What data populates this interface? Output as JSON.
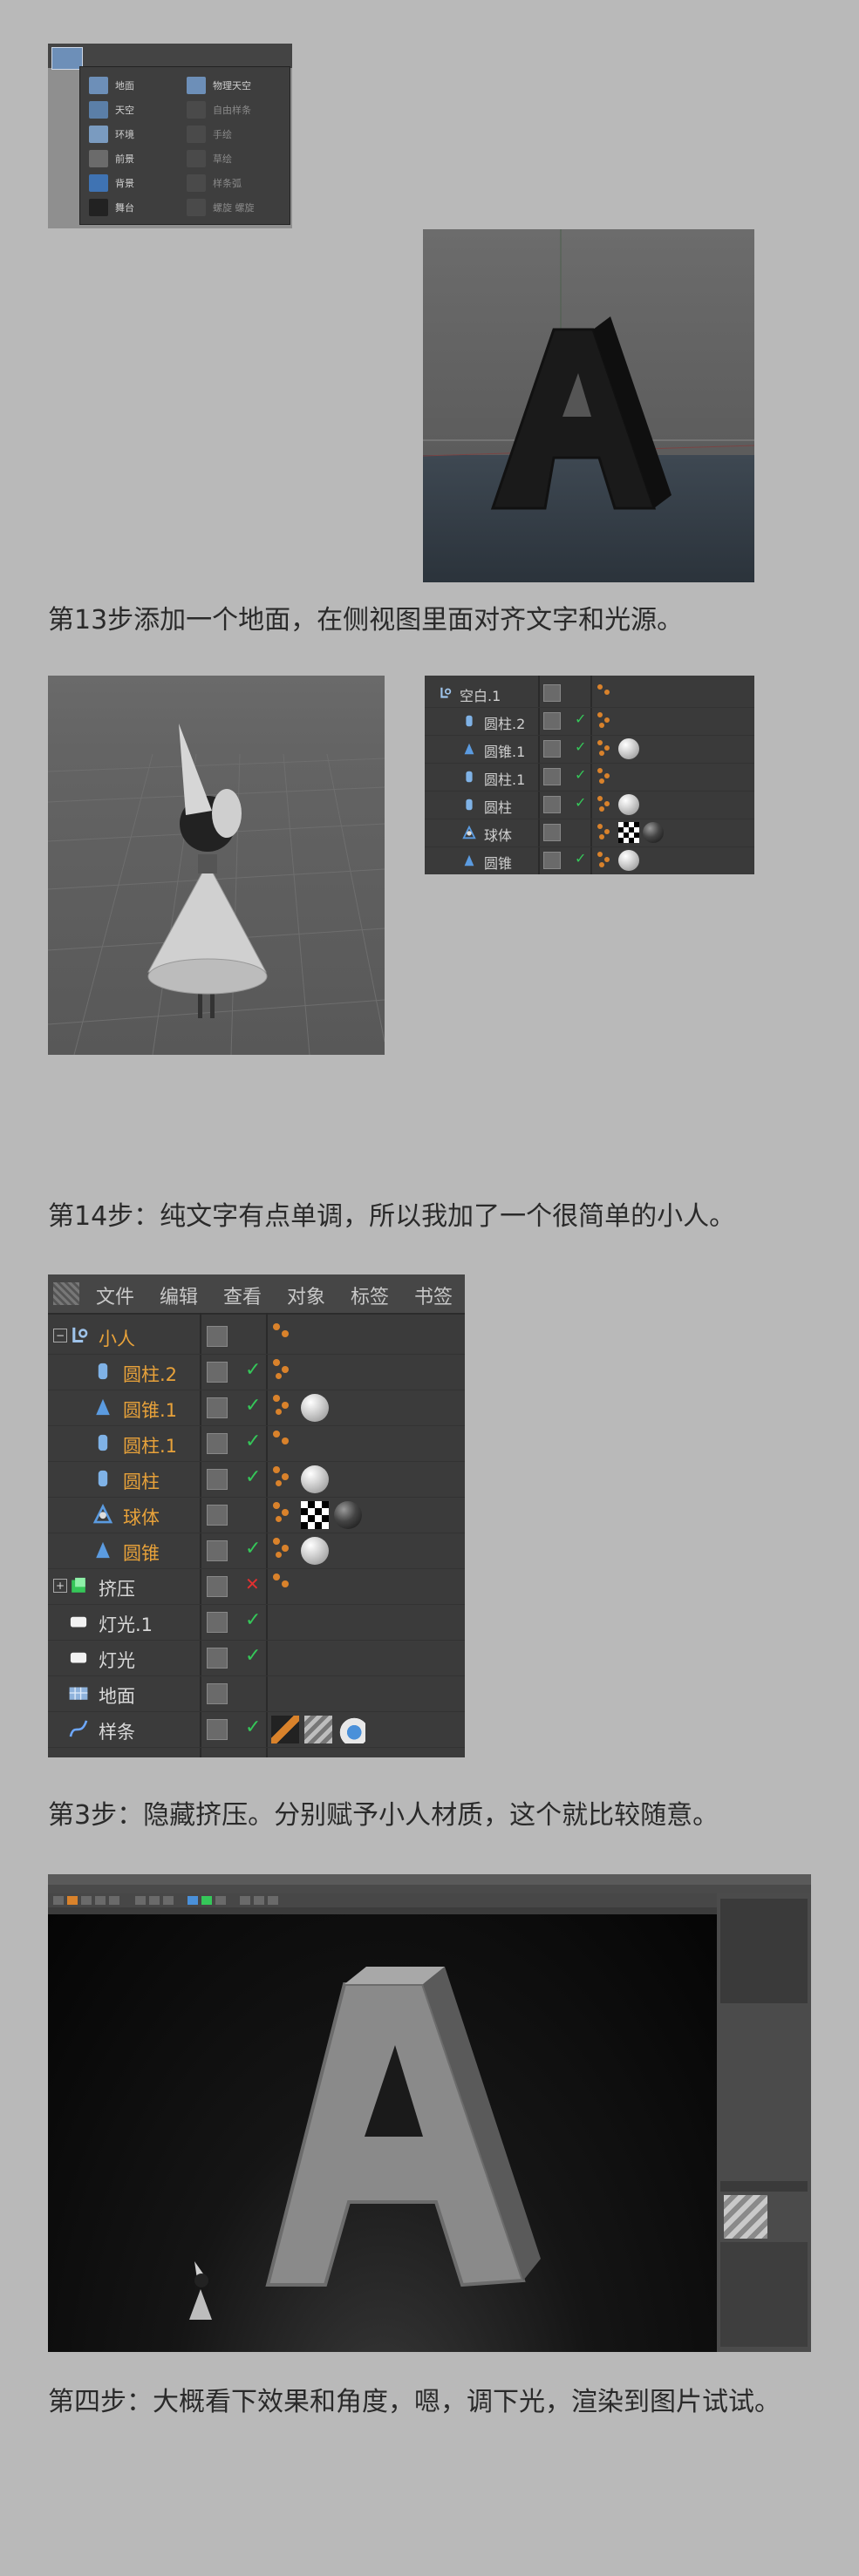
{
  "menu_screenshot": {
    "left_items": [
      "地面",
      "天空",
      "环境",
      "前景",
      "背景",
      "舞台"
    ],
    "right_items": [
      "物理天空",
      "自由样条",
      "手绘",
      "草绘",
      "样条弧",
      "螺旋 螺旋"
    ],
    "icons": [
      "floor-icon",
      "sky-icon",
      "environment-icon",
      "foreground-icon",
      "background-icon",
      "stage-icon",
      "physical-sky-icon",
      "freehand-spline-icon",
      "sketch-icon",
      "draw-icon",
      "spline-arc-icon",
      "helix-icon"
    ]
  },
  "captions": {
    "step13": "第13步添加一个地面，在侧视图里面对齐文字和光源。",
    "step14": "第14步：纯文字有点单调，所以我加了一个很简单的小人。",
    "step3": "第3步：隐藏挤压。分别赋予小人材质，这个就比较随意。",
    "step4": "第四步：大概看下效果和角度，嗯，调下光，渲染到图片试试。"
  },
  "viewport_a": {
    "letter": "A"
  },
  "om_small": {
    "rows": [
      {
        "name": "空白.1",
        "icon": "null-icon",
        "check": false,
        "tags": "dot2"
      },
      {
        "name": "圆柱.2",
        "icon": "cylinder-icon",
        "check": true,
        "tags": "dots"
      },
      {
        "name": "圆锥.1",
        "icon": "cone-icon",
        "check": true,
        "tags": "dots-ball"
      },
      {
        "name": "圆柱.1",
        "icon": "cylinder-icon",
        "check": true,
        "tags": "dots"
      },
      {
        "name": "圆柱",
        "icon": "cylinder-icon",
        "check": true,
        "tags": "dots-ball"
      },
      {
        "name": "球体",
        "icon": "sphere-icon",
        "check": false,
        "tags": "dots-checker-dark"
      },
      {
        "name": "圆锥",
        "icon": "cone-icon",
        "check": true,
        "tags": "dots-ball"
      }
    ]
  },
  "om_big": {
    "menu": [
      "文件",
      "编辑",
      "查看",
      "对象",
      "标签",
      "书签"
    ],
    "rows": [
      {
        "name": "小人",
        "icon": "null-icon",
        "color": "#e8a23a",
        "check": false,
        "cross": false
      },
      {
        "name": "圆柱.2",
        "icon": "cylinder-icon",
        "color": "#e8a23a",
        "check": true,
        "cross": false
      },
      {
        "name": "圆锥.1",
        "icon": "cone-icon",
        "color": "#e8a23a",
        "check": true,
        "cross": false
      },
      {
        "name": "圆柱.1",
        "icon": "cylinder-icon",
        "color": "#e8a23a",
        "check": true,
        "cross": false
      },
      {
        "name": "圆柱",
        "icon": "cylinder-icon",
        "color": "#e8a23a",
        "check": true,
        "cross": false
      },
      {
        "name": "球体",
        "icon": "sphere-icon",
        "color": "#e8a23a",
        "check": false,
        "cross": false
      },
      {
        "name": "圆锥",
        "icon": "cone-icon",
        "color": "#e8a23a",
        "check": true,
        "cross": false
      },
      {
        "name": "挤压",
        "icon": "extrude-icon",
        "color": "#d8d8d8",
        "check": false,
        "cross": true
      },
      {
        "name": "灯光.1",
        "icon": "light-icon",
        "color": "#d8d8d8",
        "check": true,
        "cross": false
      },
      {
        "name": "灯光",
        "icon": "light-icon",
        "color": "#d8d8d8",
        "check": true,
        "cross": false
      },
      {
        "name": "地面",
        "icon": "floor-icon",
        "color": "#d8d8d8",
        "check": false,
        "cross": false
      },
      {
        "name": "样条",
        "icon": "spline-icon",
        "color": "#d8d8d8",
        "check": true,
        "cross": false
      }
    ]
  },
  "render": {
    "letter": "A"
  },
  "colors": {
    "background": "#b9b9b9",
    "accent_orange": "#e8a23a",
    "check_green": "#35c759"
  }
}
